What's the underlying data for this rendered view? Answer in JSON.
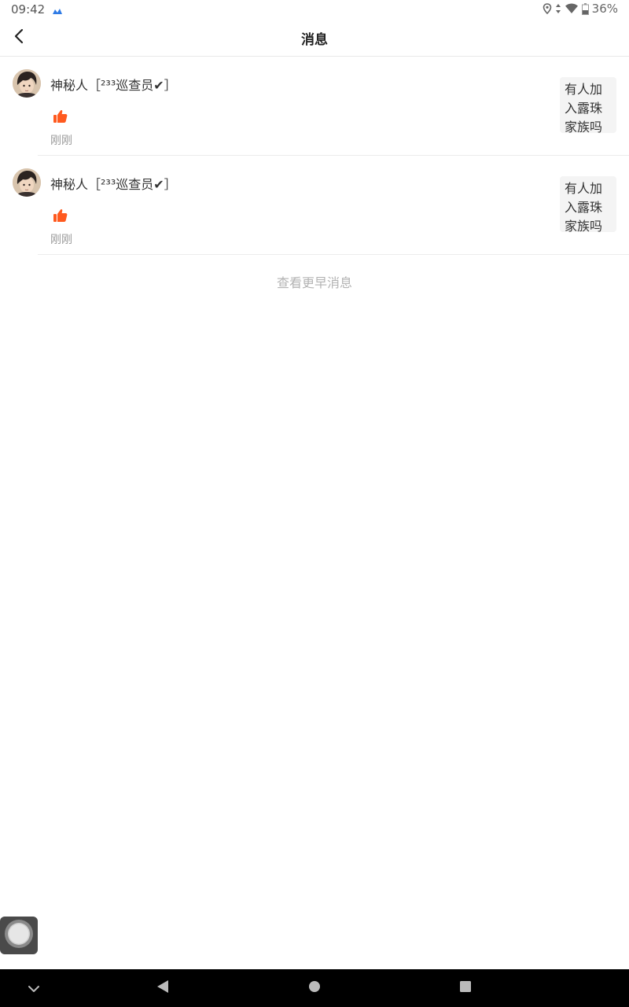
{
  "status_bar": {
    "time": "09:42",
    "battery": "36%",
    "icons": [
      "app-notification-icon",
      "location-icon",
      "data-arrows-icon",
      "wifi-icon",
      "battery-icon"
    ]
  },
  "header": {
    "title": "消息",
    "back_icon": "chevron-left-icon"
  },
  "messages": [
    {
      "user": "神秘人［²³³巡查员✔］",
      "action_icon": "thumbs-up-icon",
      "time": "刚刚",
      "preview": "有人加入露珠家族吗"
    },
    {
      "user": "神秘人［²³³巡查员✔］",
      "action_icon": "thumbs-up-icon",
      "time": "刚刚",
      "preview": "有人加入露珠家族吗"
    }
  ],
  "more_link": "查看更早消息",
  "nav_bar": {
    "icons": [
      "chevron-down-icon",
      "back-triangle-icon",
      "home-circle-icon",
      "recents-square-icon"
    ]
  },
  "colors": {
    "accent_like": "#ff5a1f",
    "title": "#222222",
    "muted": "#999999",
    "more": "#b3b3b3"
  }
}
